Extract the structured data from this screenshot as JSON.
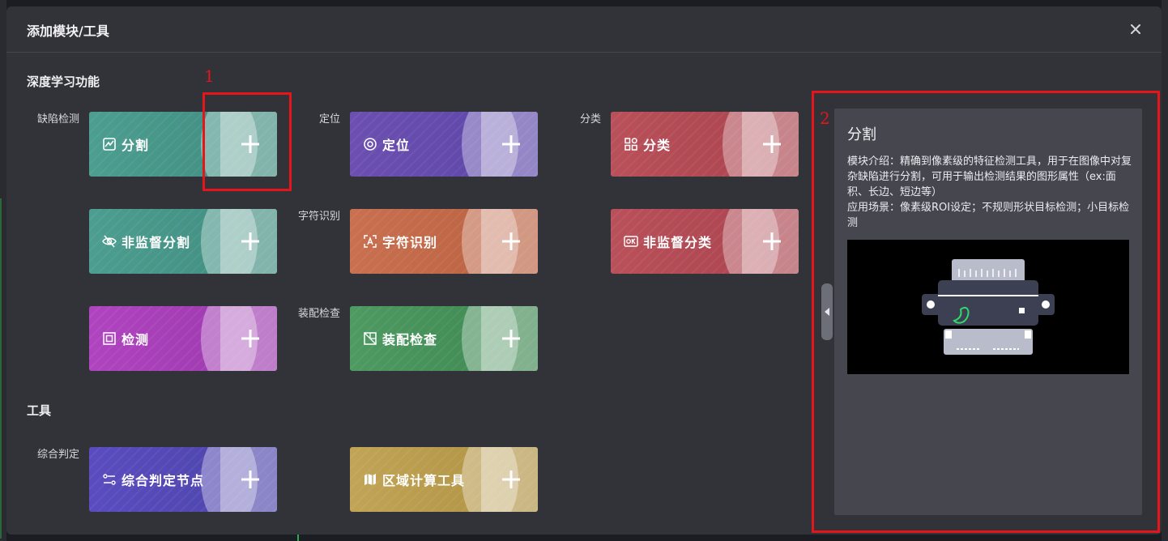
{
  "dialog": {
    "title": "添加模块/工具"
  },
  "sections": {
    "deep_learning": "深度学习功能",
    "tools": "工具"
  },
  "row_labels": {
    "defect_detection": "缺陷检测",
    "positioning": "定位",
    "classification": "分类",
    "char_recognition": "字符识别",
    "assembly_check": "装配检查",
    "composite_judgment": "综合判定"
  },
  "cards": {
    "segmentation": "分割",
    "positioning": "定位",
    "classification": "分类",
    "unsupervised_segmentation": "非监督分割",
    "char_recognition": "字符识别",
    "unsupervised_classification": "非监督分类",
    "detection": "检测",
    "assembly_check": "装配检查",
    "composite_node": "综合判定节点",
    "area_calc_tool": "区域计算工具"
  },
  "detail": {
    "title": "分割",
    "intro": "模块介绍：精确到像素级的特征检测工具，用于在图像中对复杂缺陷进行分割，可用于输出检测结果的图形属性（ex:面积、长边、短边等）",
    "scenario": "应用场景：像素级ROI设定；不规则形状目标检测；小目标检测"
  },
  "annotations": {
    "box1": "1",
    "box2": "2"
  },
  "colors": {
    "annotation": "#e4161c",
    "teal": "#4c9e90",
    "purple": "#6c4fb0",
    "red": "#b9505a",
    "orange": "#c97050",
    "magenta": "#b044c0",
    "green": "#4e9a62",
    "indigo": "#5a4cbf",
    "gold": "#c2a456"
  }
}
